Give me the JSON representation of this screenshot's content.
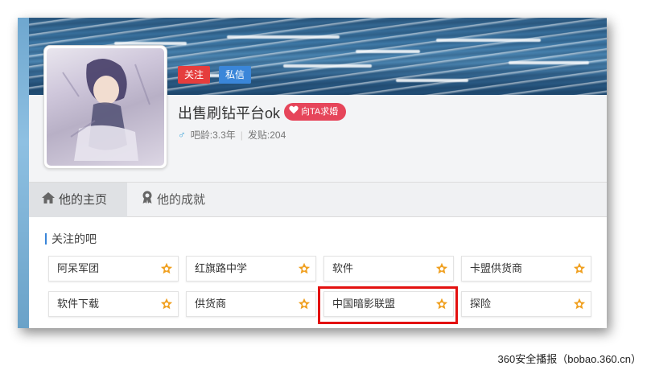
{
  "profile": {
    "follow_label": "关注",
    "message_label": "私信",
    "username": "出售刷钻平台ok",
    "propose_label": "向TA求婚",
    "age_text": "吧龄:3.3年",
    "posts_text": "发贴:204"
  },
  "tabs": [
    {
      "label": "他的主页",
      "icon": "home-icon"
    },
    {
      "label": "他的成就",
      "icon": "medal-icon"
    }
  ],
  "forums": {
    "title": "关注的吧",
    "items": [
      {
        "name": "阿呆军团"
      },
      {
        "name": "红旗路中学"
      },
      {
        "name": "软件"
      },
      {
        "name": "卡盟供货商"
      },
      {
        "name": "软件下载"
      },
      {
        "name": "供货商"
      },
      {
        "name": "中国暗影联盟"
      },
      {
        "name": "探险"
      }
    ]
  },
  "watermark": "360安全播报（bobao.360.cn）",
  "colors": {
    "follow": "#e53d3d",
    "message": "#3a86d9",
    "propose": "#e6455a",
    "highlight": "#e3100f",
    "star": "#f0a020"
  }
}
